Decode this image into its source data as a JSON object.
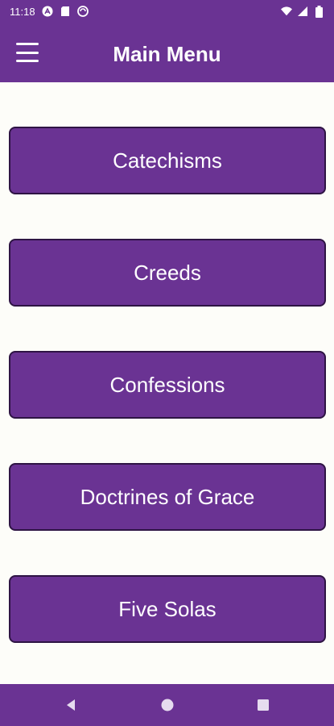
{
  "status_bar": {
    "time": "11:18",
    "icons_left": [
      "a-icon",
      "sd-card-icon",
      "sync-icon"
    ],
    "icons_right": [
      "wifi-icon",
      "signal-icon",
      "battery-icon"
    ]
  },
  "app_bar": {
    "title": "Main Menu",
    "menu_icon": "hamburger-icon"
  },
  "menu": {
    "items": [
      {
        "label": "Catechisms"
      },
      {
        "label": "Creeds"
      },
      {
        "label": "Confessions"
      },
      {
        "label": "Doctrines of Grace"
      },
      {
        "label": "Five Solas"
      }
    ]
  },
  "nav_bar": {
    "buttons": [
      "back-icon",
      "home-icon",
      "recents-icon"
    ]
  },
  "colors": {
    "primary": "#6a3393",
    "button_border": "#2e1444",
    "background": "#fdfdf9",
    "text_on_primary": "#ffffff"
  }
}
